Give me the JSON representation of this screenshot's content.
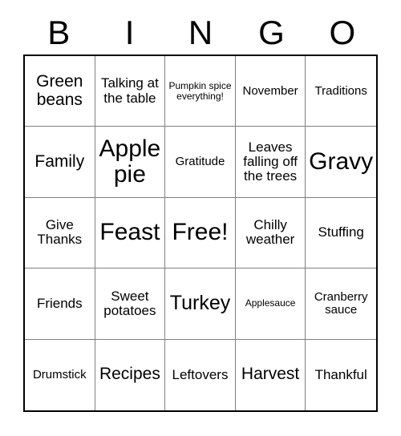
{
  "card": {
    "type": "bingo-card",
    "theme": "Thanksgiving",
    "columns": 5,
    "rows": 5,
    "grid_border_color": "#000000",
    "cell_border_color": "#808080",
    "background_color": "#ffffff",
    "text_color": "#000000"
  },
  "header": {
    "letters": [
      "B",
      "I",
      "N",
      "G",
      "O"
    ]
  },
  "grid": {
    "cells": [
      {
        "text": "Green beans",
        "size": "lg"
      },
      {
        "text": "Talking at the table",
        "size": "md"
      },
      {
        "text": "Pumpkin spice everything!",
        "size": "xs"
      },
      {
        "text": "November",
        "size": "sm"
      },
      {
        "text": "Traditions",
        "size": "sm"
      },
      {
        "text": "Family",
        "size": "lg"
      },
      {
        "text": "Apple pie",
        "size": "xxl"
      },
      {
        "text": "Gratitude",
        "size": "sm"
      },
      {
        "text": "Leaves falling off the trees",
        "size": "md"
      },
      {
        "text": "Gravy",
        "size": "xxl"
      },
      {
        "text": "Give Thanks",
        "size": "md"
      },
      {
        "text": "Feast",
        "size": "xxl"
      },
      {
        "text": "Free!",
        "size": "xxl"
      },
      {
        "text": "Chilly weather",
        "size": "md"
      },
      {
        "text": "Stuffing",
        "size": "md"
      },
      {
        "text": "Friends",
        "size": "md"
      },
      {
        "text": "Sweet potatoes",
        "size": "md"
      },
      {
        "text": "Turkey",
        "size": "xl"
      },
      {
        "text": "Applesauce",
        "size": "xs"
      },
      {
        "text": "Cranberry sauce",
        "size": "sm"
      },
      {
        "text": "Drumstick",
        "size": "sm"
      },
      {
        "text": "Recipes",
        "size": "lg"
      },
      {
        "text": "Leftovers",
        "size": "md"
      },
      {
        "text": "Harvest",
        "size": "lg"
      },
      {
        "text": "Thankful",
        "size": "md"
      }
    ]
  }
}
